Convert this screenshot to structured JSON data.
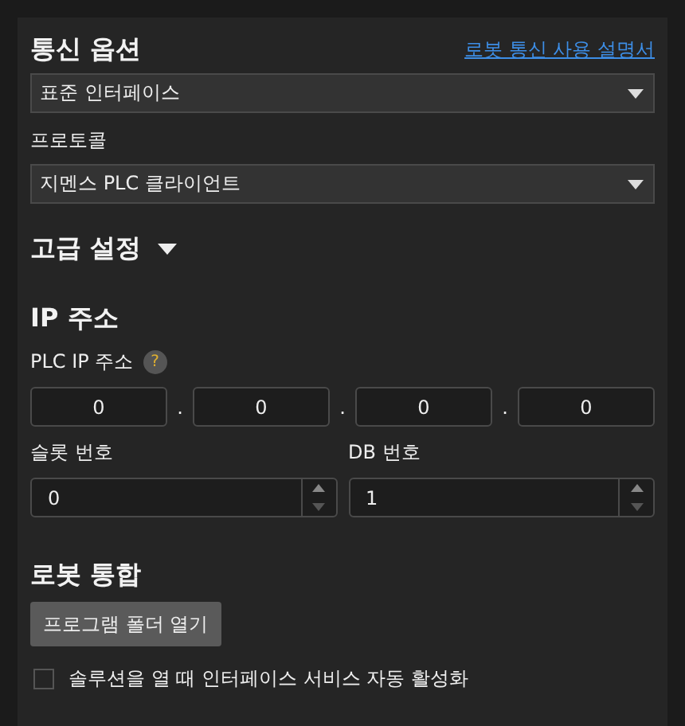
{
  "communication_options": {
    "title": "통신 옵션",
    "manual_link": "로봇 통신 사용 설명서",
    "interface_select": {
      "value": "표준 인터페이스"
    },
    "protocol_label": "프로토콜",
    "protocol_select": {
      "value": "지멘스 PLC 클라이언트"
    }
  },
  "advanced_settings": {
    "title": "고급 설정",
    "expanded": true
  },
  "ip_address": {
    "title": "IP 주소",
    "plc_ip_label": "PLC IP 주소",
    "help": "?",
    "octets": [
      "0",
      "0",
      "0",
      "0"
    ],
    "separators": [
      ".",
      ".",
      "."
    ],
    "slot": {
      "label": "슬롯 번호",
      "value": "0"
    },
    "db": {
      "label": "DB 번호",
      "value": "1"
    }
  },
  "robot_integration": {
    "title": "로봇 통합",
    "open_folder_button": "프로그램 폴더 열기",
    "auto_activate": {
      "label": "솔루션을 열 때 인터페이스 서비스 자동 활성화",
      "checked": false
    }
  }
}
